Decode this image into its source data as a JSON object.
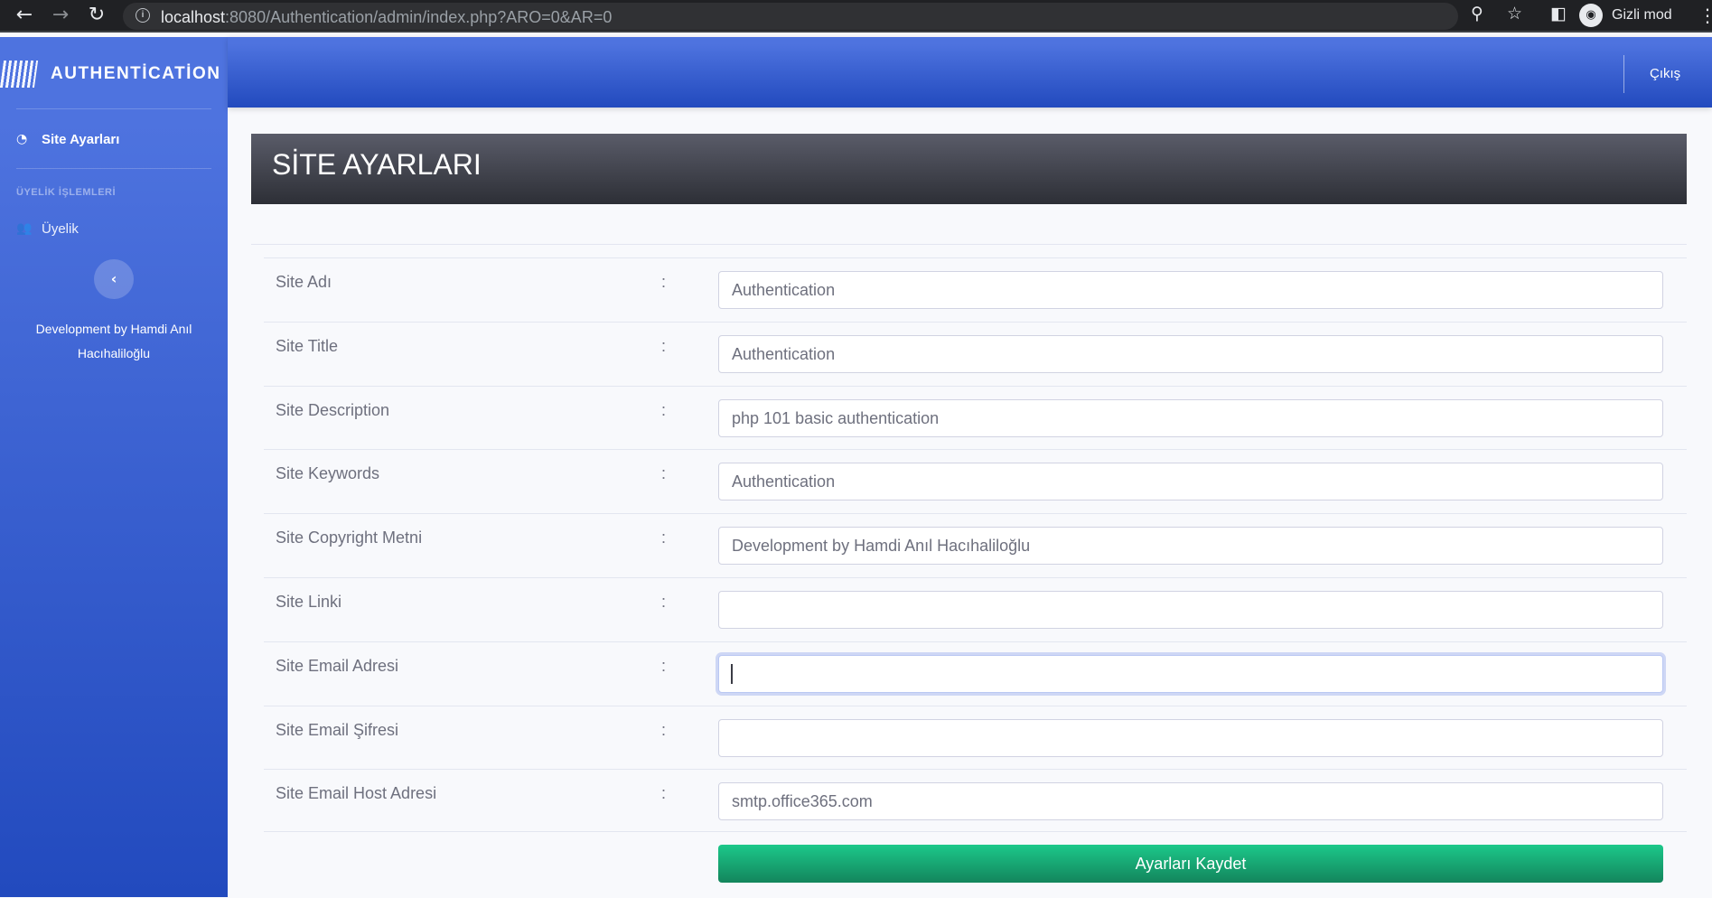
{
  "browser": {
    "url_host": "localhost",
    "url_rest": ":8080/Authentication/admin/index.php?ARO=0&AR=0",
    "incognito_label": "Gizli mod",
    "icons": [
      "back-arrow-icon",
      "forward-arrow-icon",
      "reload-icon",
      "info-icon",
      "zoom-icon",
      "star-icon",
      "sidepanel-icon",
      "incognito-icon",
      "menu-dots-icon"
    ]
  },
  "sidebar": {
    "brand": "AUTHENTİCATİON",
    "items": [
      {
        "label": "Site Ayarları",
        "icon": "dashboard-icon"
      },
      {
        "label": "Üyelik",
        "icon": "users-icon"
      }
    ],
    "heading": "ÜYELİK İŞLEMLERİ",
    "footer_line1": "Development by Hamdi Anıl",
    "footer_line2": "Hacıhaliloğlu"
  },
  "topbar": {
    "logout_label": "Çıkış"
  },
  "page": {
    "title": "SİTE AYARLARI"
  },
  "form": {
    "colon": ":",
    "fields": [
      {
        "label": "Site Adı",
        "value": "Authentication"
      },
      {
        "label": "Site Title",
        "value": "Authentication"
      },
      {
        "label": "Site Description",
        "value": "php 101 basic authentication"
      },
      {
        "label": "Site Keywords",
        "value": "Authentication"
      },
      {
        "label": "Site Copyright Metni",
        "value": "Development by Hamdi Anıl Hacıhaliloğlu"
      },
      {
        "label": "Site Linki",
        "value": ""
      },
      {
        "label": "Site Email Adresi",
        "value": ""
      },
      {
        "label": "Site Email Şifresi",
        "value": ""
      },
      {
        "label": "Site Email Host Adresi",
        "value": "smtp.office365.com"
      }
    ],
    "save_label": "Ayarları Kaydet"
  },
  "colors": {
    "primary": "#4e73df",
    "primary_dark": "#224abe",
    "success": "#1cc88a",
    "header_dark": "#2d2f36"
  }
}
